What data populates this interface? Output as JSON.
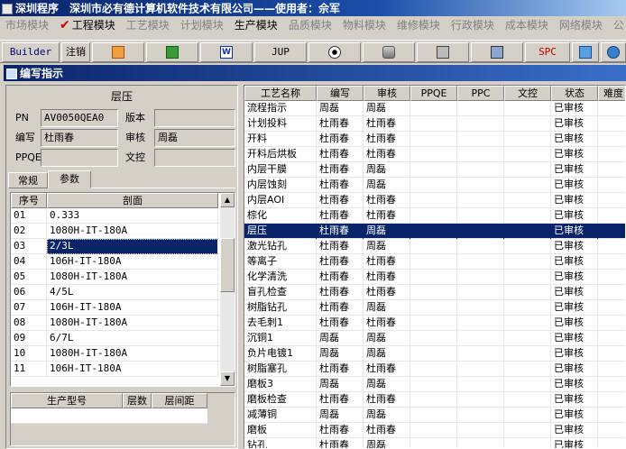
{
  "window": {
    "title": "深圳程序　深圳市必有德计算机软件技术有限公司——使用者：佘军"
  },
  "menu": [
    {
      "label": "市场模块",
      "enabled": false
    },
    {
      "label": "工程模块",
      "enabled": true,
      "checked": true
    },
    {
      "label": "工艺模块",
      "enabled": false
    },
    {
      "label": "计划模块",
      "enabled": false
    },
    {
      "label": "生产模块",
      "enabled": true
    },
    {
      "label": "品质模块",
      "enabled": false
    },
    {
      "label": "物料模块",
      "enabled": false
    },
    {
      "label": "维修模块",
      "enabled": false
    },
    {
      "label": "行政模块",
      "enabled": false
    },
    {
      "label": "成本模块",
      "enabled": false
    },
    {
      "label": "网络模块",
      "enabled": false
    },
    {
      "label": "公",
      "enabled": false
    }
  ],
  "toolbar": {
    "builder": "Builder",
    "logout": "注销",
    "jup": "JUP",
    "spc": "SPC"
  },
  "form": {
    "title": "编写指示"
  },
  "left": {
    "header": "层压",
    "pn_label": "PN",
    "pn_value": "AV0050QEA0",
    "version_label": "版本",
    "version_value": "",
    "writer_label": "编写",
    "writer_value": "杜雨春",
    "review_label": "审核",
    "review_value": "周磊",
    "ppqe_label": "PPQE",
    "ppqe_value": "",
    "doc_label": "文控",
    "doc_value": "",
    "tabs": [
      "常规",
      "参数"
    ],
    "grid": {
      "headers": [
        "序号",
        "剖面"
      ],
      "selected": 2,
      "rows": [
        [
          "01",
          "0.333"
        ],
        [
          "02",
          "1080H-IT-180A"
        ],
        [
          "03",
          "2/3L"
        ],
        [
          "04",
          "106H-IT-180A"
        ],
        [
          "05",
          "1080H-IT-180A"
        ],
        [
          "06",
          "4/5L"
        ],
        [
          "07",
          "106H-IT-180A"
        ],
        [
          "08",
          "1080H-IT-180A"
        ],
        [
          "09",
          "6/7L"
        ],
        [
          "10",
          "1080H-IT-180A"
        ],
        [
          "11",
          "106H-IT-180A"
        ]
      ]
    },
    "grid2": {
      "headers": [
        "生产型号",
        "层数",
        "层间距"
      ]
    }
  },
  "right": {
    "headers": [
      "工艺名称",
      "编写",
      "审核",
      "PPQE",
      "PPC",
      "文控",
      "状态",
      "难度"
    ],
    "selected": 8,
    "rows": [
      [
        "流程指示",
        "周磊",
        "周磊",
        "",
        "",
        "",
        "已审核"
      ],
      [
        "计划投料",
        "杜雨春",
        "杜雨春",
        "",
        "",
        "",
        "已审核"
      ],
      [
        "开料",
        "杜雨春",
        "杜雨春",
        "",
        "",
        "",
        "已审核"
      ],
      [
        "开料后烘板",
        "杜雨春",
        "杜雨春",
        "",
        "",
        "",
        "已审核"
      ],
      [
        "内层干膜",
        "杜雨春",
        "周磊",
        "",
        "",
        "",
        "已审核"
      ],
      [
        "内层蚀刻",
        "杜雨春",
        "周磊",
        "",
        "",
        "",
        "已审核"
      ],
      [
        "内层AOI",
        "杜雨春",
        "杜雨春",
        "",
        "",
        "",
        "已审核"
      ],
      [
        "棕化",
        "杜雨春",
        "杜雨春",
        "",
        "",
        "",
        "已审核"
      ],
      [
        "层压",
        "杜雨春",
        "周磊",
        "",
        "",
        "",
        "已审核"
      ],
      [
        "激光钻孔",
        "杜雨春",
        "周磊",
        "",
        "",
        "",
        "已审核"
      ],
      [
        "等离子",
        "杜雨春",
        "杜雨春",
        "",
        "",
        "",
        "已审核"
      ],
      [
        "化学清洗",
        "杜雨春",
        "杜雨春",
        "",
        "",
        "",
        "已审核"
      ],
      [
        "盲孔检查",
        "杜雨春",
        "杜雨春",
        "",
        "",
        "",
        "已审核"
      ],
      [
        "树脂钻孔",
        "杜雨春",
        "周磊",
        "",
        "",
        "",
        "已审核"
      ],
      [
        "去毛刺1",
        "杜雨春",
        "杜雨春",
        "",
        "",
        "",
        "已审核"
      ],
      [
        "沉铜1",
        "周磊",
        "周磊",
        "",
        "",
        "",
        "已审核"
      ],
      [
        "负片电镀1",
        "周磊",
        "周磊",
        "",
        "",
        "",
        "已审核"
      ],
      [
        "树脂塞孔",
        "杜雨春",
        "杜雨春",
        "",
        "",
        "",
        "已审核"
      ],
      [
        "磨板3",
        "周磊",
        "周磊",
        "",
        "",
        "",
        "已审核"
      ],
      [
        "磨板检查",
        "杜雨春",
        "杜雨春",
        "",
        "",
        "",
        "已审核"
      ],
      [
        "减薄铜",
        "周磊",
        "周磊",
        "",
        "",
        "",
        "已审核"
      ],
      [
        "磨板",
        "杜雨春",
        "杜雨春",
        "",
        "",
        "",
        "已审核"
      ],
      [
        "钻孔",
        "杜雨春",
        "周磊",
        "",
        "",
        "",
        "已审核"
      ]
    ]
  }
}
